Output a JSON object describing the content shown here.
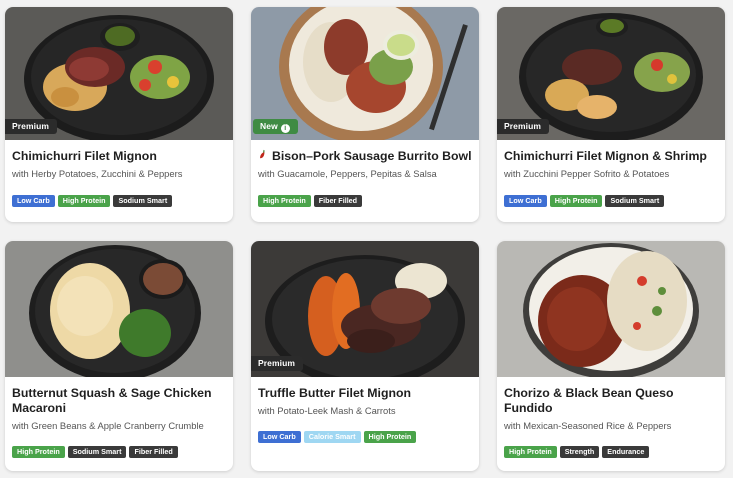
{
  "colors": {
    "low_carb": "#3e6fd3",
    "high_protein": "#4aa34a",
    "dark_tag": "#3a3a3a",
    "calorie_smart": "#9fd7f2",
    "new_badge": "#3f8b43",
    "premium_badge": "#2b2b2b"
  },
  "meals": [
    {
      "badge": "Premium",
      "title": "Chimichurri Filet Mignon",
      "subtitle": "with Herby Potatoes, Zucchini & Peppers",
      "tags": [
        "Low Carb",
        "High Protein",
        "Sodium Smart"
      ]
    },
    {
      "badge": "New",
      "badge_icon": "info-icon",
      "title_icon": "chili-pepper-icon",
      "title": "Bison–Pork Sausage Burrito Bowl",
      "subtitle": "with Guacamole, Peppers, Pepitas & Salsa",
      "tags": [
        "High Protein",
        "Fiber Filled"
      ]
    },
    {
      "badge": "Premium",
      "title": "Chimichurri Filet Mignon & Shrimp",
      "subtitle": "with Zucchini Pepper Sofrito & Potatoes",
      "tags": [
        "Low Carb",
        "High Protein",
        "Sodium Smart"
      ]
    },
    {
      "title": "Butternut Squash & Sage Chicken Macaroni",
      "subtitle": "with Green Beans & Apple Cranberry Crumble",
      "tags": [
        "High Protein",
        "Sodium Smart",
        "Fiber Filled"
      ]
    },
    {
      "badge": "Premium",
      "title": "Truffle Butter Filet Mignon",
      "subtitle": "with Potato-Leek Mash & Carrots",
      "tags": [
        "Low Carb",
        "Calorie Smart",
        "High Protein"
      ]
    },
    {
      "title": "Chorizo & Black Bean Queso Fundido",
      "subtitle": "with Mexican-Seasoned Rice & Peppers",
      "tags": [
        "High Protein",
        "Strength",
        "Endurance"
      ]
    }
  ]
}
